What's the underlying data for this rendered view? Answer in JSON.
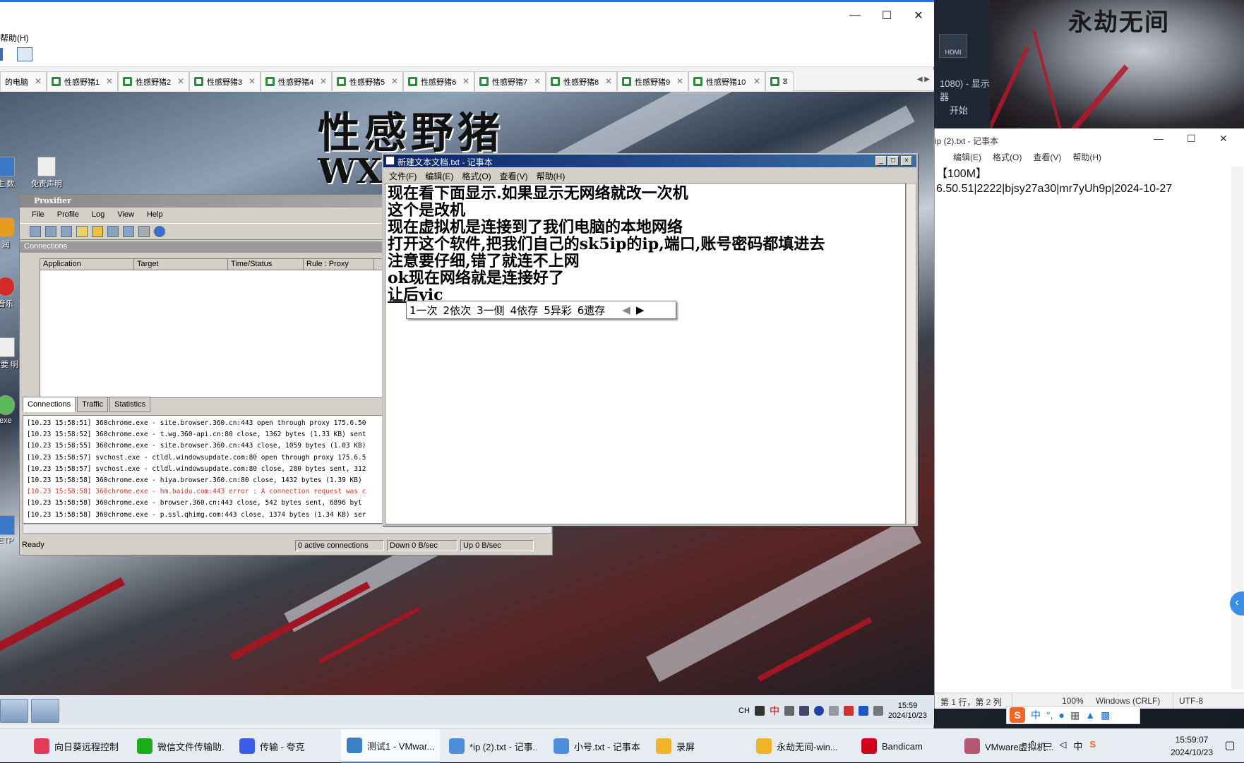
{
  "host": {
    "art_title": "永劫无间",
    "hdmi_label": "HDMI",
    "left_strip_text1": "1080) - 显示器",
    "left_strip_text2": "开始"
  },
  "vmware": {
    "menu_help": "帮助(H)",
    "tabs": [
      {
        "label": "的电脑"
      },
      {
        "label": "性感野猪1"
      },
      {
        "label": "性感野猪2"
      },
      {
        "label": "性感野猪3"
      },
      {
        "label": "性感野猪4"
      },
      {
        "label": "性感野猪5"
      },
      {
        "label": "性感野猪6"
      },
      {
        "label": "性感野猪7"
      },
      {
        "label": "性感野猪8"
      },
      {
        "label": "性感野猪9"
      },
      {
        "label": "性感野猪10"
      },
      {
        "label": "3"
      }
    ],
    "wallpaper_title": "性感野猪",
    "wallpaper_sub": "WX"
  },
  "guest_desktop": {
    "icons": [
      {
        "label": "主 数"
      },
      {
        "label": "免责声明"
      },
      {
        "label": "润"
      },
      {
        "label": "音乐"
      },
      {
        "label": "重要 明"
      },
      {
        "label": "exe"
      },
      {
        "label": "ETP"
      }
    ]
  },
  "proxifier": {
    "title": "Proxifier",
    "menu": [
      "File",
      "Profile",
      "Log",
      "View",
      "Help"
    ],
    "connections_label": "Connections",
    "columns": [
      "Application",
      "Target",
      "Time/Status",
      "Rule : Proxy"
    ],
    "tabs": [
      "Connections",
      "Traffic",
      "Statistics"
    ],
    "log": [
      {
        "text": "[10.23 15:58:51] 360chrome.exe - site.browser.360.cn:443 open through proxy 175.6.50",
        "error": false
      },
      {
        "text": "[10.23 15:58:52] 360chrome.exe - t.wg.360-api.cn:80 close, 1362 bytes (1.33 KB) sent",
        "error": false
      },
      {
        "text": "[10.23 15:58:55] 360chrome.exe - site.browser.360.cn:443 close, 1059 bytes (1.03 KB)",
        "error": false
      },
      {
        "text": "[10.23 15:58:57] svchost.exe - ctldl.windowsupdate.com:80 open through proxy 175.6.5",
        "error": false
      },
      {
        "text": "[10.23 15:58:57] svchost.exe - ctldl.windowsupdate.com:80 close, 280 bytes sent, 312",
        "error": false
      },
      {
        "text": "[10.23 15:58:58] 360chrome.exe - hiya.browser.360.cn:80 close, 1432 bytes (1.39 KB)",
        "error": false
      },
      {
        "text": "[10.23 15:58:58] 360chrome.exe - hm.baidu.com:443 error : A connection request was c",
        "error": true
      },
      {
        "text": "[10.23 15:58:58] 360chrome.exe - browser.360.cn:443 close, 542 bytes sent, 6896 byt",
        "error": false
      },
      {
        "text": "[10.23 15:58:58] 360chrome.exe - p.ssl.qhimg.com:443 close, 1374 bytes (1.34 KB) ser",
        "error": false
      }
    ],
    "status": {
      "ready": "Ready",
      "active": "0 active connections",
      "down": "Down 0 B/sec",
      "up": "Up 0 B/sec"
    }
  },
  "guest_notepad": {
    "title": "新建文本文档.txt - 记事本",
    "menu": [
      "文件(F)",
      "编辑(E)",
      "格式(O)",
      "查看(V)",
      "帮助(H)"
    ],
    "lines": [
      "现在看下面显示.如果显示无网络就改一次机",
      "这个是改机",
      "现在虚拟机是连接到了我们电脑的本地网络",
      "打开这个软件,把我们自己的sk5ip的ip,端口,账号密码都填进去",
      "注意要仔细,错了就连不上网",
      "ok现在网络就是连接好了",
      "让后yic"
    ],
    "ime_candidates": [
      "1一次",
      "2依次",
      "3一侧",
      "4依存",
      "5异彩",
      "6遗存"
    ]
  },
  "guest_taskbar": {
    "tray_lang": "CH",
    "tray_ime": "中",
    "time": "15:59",
    "date": "2024/10/23"
  },
  "host_notepad": {
    "title": "ip (2).txt - 记事本",
    "menu": [
      "编辑(E)",
      "格式(O)",
      "查看(V)",
      "帮助(H)"
    ],
    "line1": "【100M】",
    "line2": "6.50.51|2222|bjsy27a30|mr7yUh9p|2024-10-27",
    "status": {
      "position": "第 1 行，第 2 列",
      "zoom": "100%",
      "eol": "Windows (CRLF)",
      "encoding": "UTF-8"
    }
  },
  "host_ime": {
    "mode": "中"
  },
  "host_taskbar": {
    "items": [
      {
        "label": "向日葵远程控制",
        "color": "#e23a57"
      },
      {
        "label": "微信文件传输助...",
        "color": "#1aad19"
      },
      {
        "label": "传输 - 夸克",
        "color": "#3a5ae8"
      },
      {
        "label": "测试1 - VMwar...",
        "color": "#3d7fc4"
      },
      {
        "label": "*ip (2).txt - 记事...",
        "color": "#4c8ed9"
      },
      {
        "label": "小号.txt - 记事本",
        "color": "#4c8ed9"
      },
      {
        "label": "录屏",
        "color": "#f0b429"
      },
      {
        "label": "永劫无间-win...",
        "color": "#f0b429"
      },
      {
        "label": "Bandicam",
        "color": "#d0021b"
      },
      {
        "label": "VMware虚拟机...",
        "color": "#b3566f"
      }
    ],
    "tray_ime": "中",
    "time": "15:59:07",
    "date": "2024/10/23"
  }
}
